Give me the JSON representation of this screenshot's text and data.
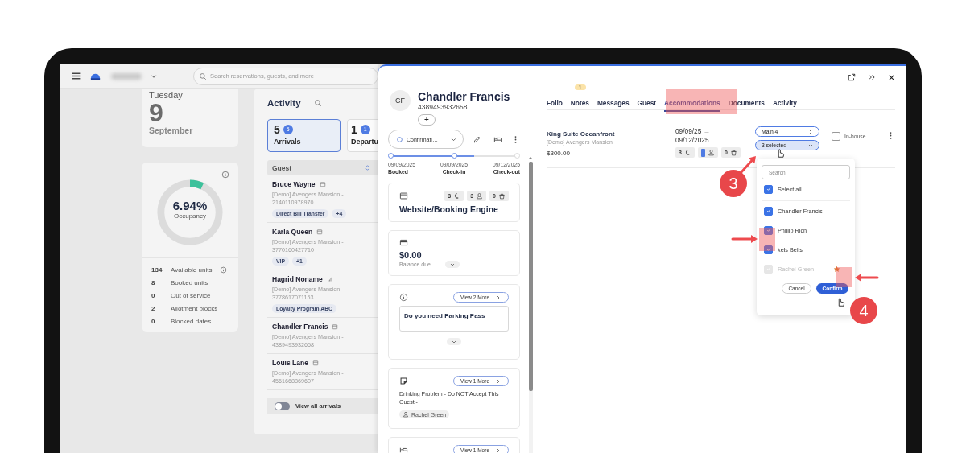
{
  "app_bar": {
    "search_placeholder": "Search reservations, guests, and more"
  },
  "date_card": {
    "weekday": "Tuesday",
    "day": "9",
    "month": "September"
  },
  "occupancy": {
    "value": "6.94%",
    "label": "Occupancy",
    "level": 0.0694,
    "stats": [
      {
        "count": "134",
        "label": "Available units",
        "info": true
      },
      {
        "count": "8",
        "label": "Booked units",
        "info": false
      },
      {
        "count": "0",
        "label": "Out of service",
        "info": false
      },
      {
        "count": "2",
        "label": "Allotment blocks",
        "info": false
      },
      {
        "count": "0",
        "label": "Blocked dates",
        "info": false
      }
    ]
  },
  "activity": {
    "title": "Activity",
    "tabs": [
      {
        "count": "5",
        "badge": "5",
        "label": "Arrivals",
        "selected": true
      },
      {
        "count": "1",
        "badge": "1",
        "label": "Departu",
        "selected": false
      }
    ],
    "column": "Guest",
    "guests": [
      {
        "name": "Bruce Wayne",
        "kind": "booking",
        "detail": "[Demo] Avengers Mansion - 2140110978970",
        "tags": [
          "Direct Bill Transfer",
          "+4"
        ]
      },
      {
        "name": "Karla Queen",
        "kind": "booking",
        "detail": "[Demo] Avengers Mansion - 3770160427710",
        "tags": [
          "VIP",
          "+1"
        ]
      },
      {
        "name": "Hagrid Noname",
        "kind": "group",
        "detail": "[Demo] Avengers Mansion - 3778617071153",
        "tags": [
          "Loyalty Program ABC"
        ]
      },
      {
        "name": "Chandler Francis",
        "kind": "booking",
        "detail": "[Demo] Avengers Mansion - 4389493932658"
      },
      {
        "name": "Louis Lane",
        "kind": "booking",
        "detail": "[Demo] Avengers Mansion - 4561668869607"
      }
    ],
    "toggle": {
      "label": "View all arrivals",
      "on": false
    }
  },
  "reservation": {
    "initials": "CF",
    "name": "Chandler Francis",
    "phone": "4389493932658",
    "add": "+",
    "status": "Confirmati…",
    "progress": {
      "level": 0.66,
      "steps": [
        {
          "date": "09/09/2025",
          "label": "Booked",
          "done": true
        },
        {
          "date": "09/09/2025",
          "label": "Check-in",
          "done": true
        },
        {
          "date": "09/12/2025",
          "label": "Check-out",
          "done": false
        }
      ]
    },
    "source": {
      "counts": [
        {
          "kind": "nights",
          "value": "3"
        },
        {
          "kind": "guests",
          "value": "3"
        },
        {
          "kind": "items",
          "value": "0"
        }
      ],
      "title": "Website/Booking Engine"
    },
    "balance": {
      "amount": "$0.00",
      "label": "Balance due"
    },
    "cards": [
      {
        "kind": "info",
        "more": "View 2 More",
        "text": "Do you need Parking Pass"
      },
      {
        "kind": "note",
        "more": "View 1 More",
        "text": "Drinking Problem - Do NOT Accept This Guest -",
        "author": "Rachel Green"
      },
      {
        "kind": "room",
        "more": "View 1 More"
      }
    ]
  },
  "detail": {
    "tabs": [
      {
        "label": "Folio",
        "selected": false
      },
      {
        "label": "Notes",
        "badge": "1",
        "selected": false
      },
      {
        "label": "Messages",
        "selected": false
      },
      {
        "label": "Guest",
        "selected": false
      },
      {
        "label": "Accommodations",
        "selected": true
      },
      {
        "label": "Documents",
        "selected": false
      },
      {
        "label": "Activity",
        "selected": false
      }
    ],
    "accommodation": {
      "room": "King Suite Oceanfront",
      "property": "[Demo] Avengers Mansion",
      "price": "$300.00",
      "arrival": "09/09/25 →",
      "departure": "09/12/2025",
      "counts": [
        {
          "kind": "nights",
          "value": "3",
          "selected": false
        },
        {
          "kind": "guests",
          "selected": true
        },
        {
          "kind": "items",
          "value": "0",
          "selected": false
        }
      ],
      "unit": "Main 4",
      "guests_select": {
        "label": "3 selected",
        "open": true
      },
      "in_house": {
        "label": "In-house",
        "checked": false
      }
    },
    "guest_dropdown": {
      "search_placeholder": "Search",
      "select_all": {
        "label": "Select all",
        "checked": true
      },
      "options": [
        {
          "name": "Chandler Francis",
          "checked": true,
          "disabled": false,
          "starred": false
        },
        {
          "name": "Phillip Rich",
          "checked": true,
          "disabled": false,
          "starred": false
        },
        {
          "name": "kels Bells",
          "checked": true,
          "disabled": false,
          "starred": false
        },
        {
          "name": "Rachel Green",
          "checked": true,
          "disabled": true,
          "starred": true
        }
      ],
      "cancel": "Cancel",
      "confirm": "Confirm"
    }
  },
  "callouts": [
    {
      "label": "3"
    },
    {
      "label": "4"
    }
  ]
}
